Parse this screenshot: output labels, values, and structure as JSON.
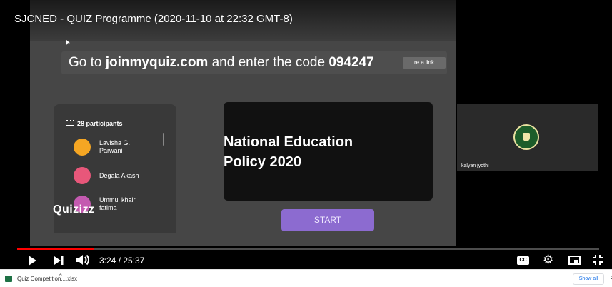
{
  "video": {
    "title": "SJCNED - QUIZ Programme (2020-11-10 at 22:32 GMT-8)",
    "slide": {
      "join_prefix": "Go to ",
      "join_site": "joinmyquiz.com",
      "join_middle": " and enter the code ",
      "join_code": "094247",
      "share_link_label": "re a link",
      "participants_count_label": "28 participants",
      "participants": [
        {
          "name": "Lavisha G. Parwani",
          "avatar_color": "#f5a623"
        },
        {
          "name": "Degala Akash",
          "avatar_color": "#e8577a"
        },
        {
          "name": "Ummul khair fatima",
          "avatar_color": "#c45ab0"
        }
      ],
      "brand_logo": "Quizizz",
      "question": "National Education\nPolicy 2020",
      "start_label": "START"
    },
    "speaker": {
      "name": "kalyan jyothi",
      "logo_icon": "college-crest-icon"
    }
  },
  "controls": {
    "time": "3:24 / 25:37",
    "progress_fraction": 0.133,
    "cc_label": "CC"
  },
  "downloads": {
    "file_name": "Quiz Competition....xlsx",
    "show_all_label": "Show all"
  },
  "colors": {
    "progress": "#ff0000",
    "start_button": "#8c6bd0",
    "excel_icon": "#1e7145"
  }
}
